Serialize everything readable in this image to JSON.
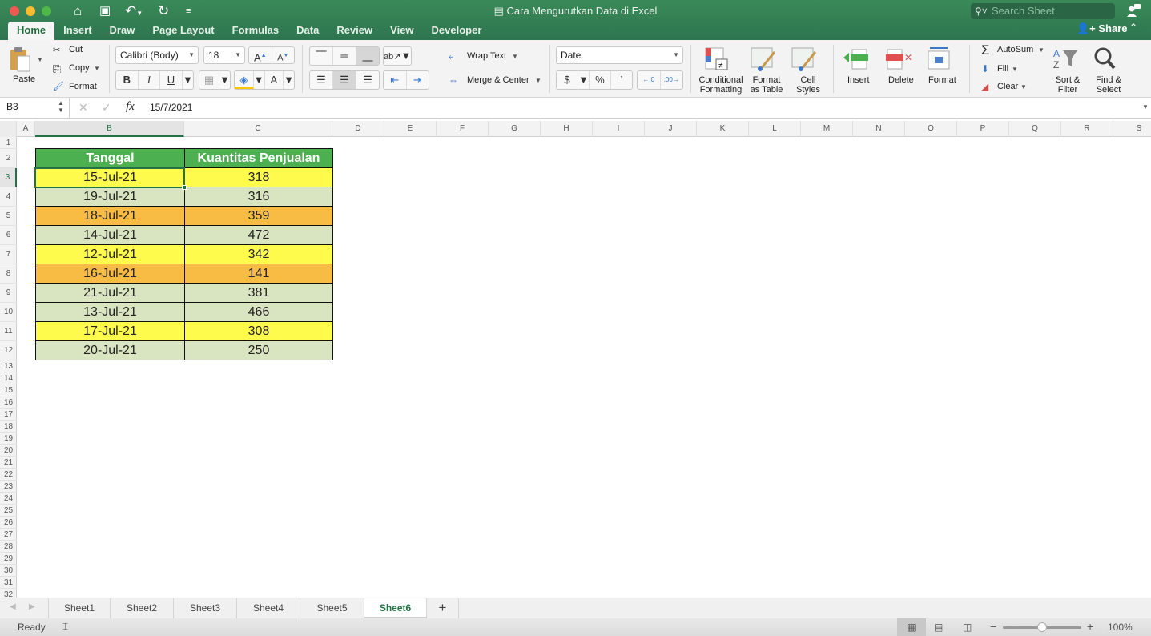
{
  "window": {
    "title": "Cara Mengurutkan Data di Excel",
    "search_placeholder": "Search Sheet",
    "share_label": "Share"
  },
  "ribbon_tabs": [
    {
      "label": "Home",
      "active": true
    },
    {
      "label": "Insert"
    },
    {
      "label": "Draw"
    },
    {
      "label": "Page Layout"
    },
    {
      "label": "Formulas"
    },
    {
      "label": "Data"
    },
    {
      "label": "Review"
    },
    {
      "label": "View"
    },
    {
      "label": "Developer"
    }
  ],
  "ribbon": {
    "clipboard": {
      "paste": "Paste",
      "cut": "Cut",
      "copy": "Copy",
      "format": "Format"
    },
    "font": {
      "name": "Calibri (Body)",
      "size": "18",
      "bold": "B",
      "italic": "I",
      "underline": "U"
    },
    "alignment": {
      "wrap_text": "Wrap Text",
      "merge_center": "Merge & Center"
    },
    "number": {
      "format": "Date",
      "currency": "$",
      "percent": "%",
      "comma": "’"
    },
    "styles": {
      "conditional": "Conditional",
      "conditional2": "Formatting",
      "format_table": "Format",
      "format_table2": "as Table",
      "cell_styles": "Cell",
      "cell_styles2": "Styles"
    },
    "cells": {
      "insert": "Insert",
      "delete": "Delete",
      "format": "Format"
    },
    "editing": {
      "autosum": "AutoSum",
      "fill": "Fill",
      "clear": "Clear",
      "sort": "Sort &",
      "sort2": "Filter",
      "find": "Find &",
      "find2": "Select"
    }
  },
  "formula_bar": {
    "name_box": "B3",
    "content": "15/7/2021"
  },
  "columns": [
    "A",
    "B",
    "C",
    "D",
    "E",
    "F",
    "G",
    "H",
    "I",
    "J",
    "K",
    "L",
    "M",
    "N",
    "O",
    "P",
    "Q",
    "R",
    "S"
  ],
  "selected_column": "B",
  "rows": [
    "1",
    "2",
    "3",
    "4",
    "5",
    "6",
    "7",
    "8",
    "9",
    "10",
    "11",
    "12",
    "13",
    "14",
    "15",
    "16",
    "17",
    "18",
    "19",
    "20",
    "21",
    "22",
    "23",
    "24",
    "25",
    "26",
    "27",
    "28",
    "29",
    "30",
    "31",
    "32"
  ],
  "selected_row": "3",
  "table": {
    "headers": [
      "Tanggal",
      "Kuantitas Penjualan"
    ],
    "rows": [
      {
        "date": "15-Jul-21",
        "qty": "318",
        "fill": "yellow"
      },
      {
        "date": "19-Jul-21",
        "qty": "316",
        "fill": "green"
      },
      {
        "date": "18-Jul-21",
        "qty": "359",
        "fill": "orange"
      },
      {
        "date": "14-Jul-21",
        "qty": "472",
        "fill": "green"
      },
      {
        "date": "12-Jul-21",
        "qty": "342",
        "fill": "yellow"
      },
      {
        "date": "16-Jul-21",
        "qty": "141",
        "fill": "orange"
      },
      {
        "date": "21-Jul-21",
        "qty": "381",
        "fill": "green"
      },
      {
        "date": "13-Jul-21",
        "qty": "466",
        "fill": "green"
      },
      {
        "date": "17-Jul-21",
        "qty": "308",
        "fill": "yellow"
      },
      {
        "date": "20-Jul-21",
        "qty": "250",
        "fill": "green"
      }
    ]
  },
  "colors": {
    "header": "#4caf50",
    "yellow": "#fffb4d",
    "green": "#d9e4c1",
    "orange": "#f8bb44",
    "accent": "#217346"
  },
  "sheets": [
    "Sheet1",
    "Sheet2",
    "Sheet3",
    "Sheet4",
    "Sheet5",
    "Sheet6"
  ],
  "active_sheet": "Sheet6",
  "status": {
    "text": "Ready",
    "zoom": "100%",
    "zoom_fraction": 0.5
  }
}
